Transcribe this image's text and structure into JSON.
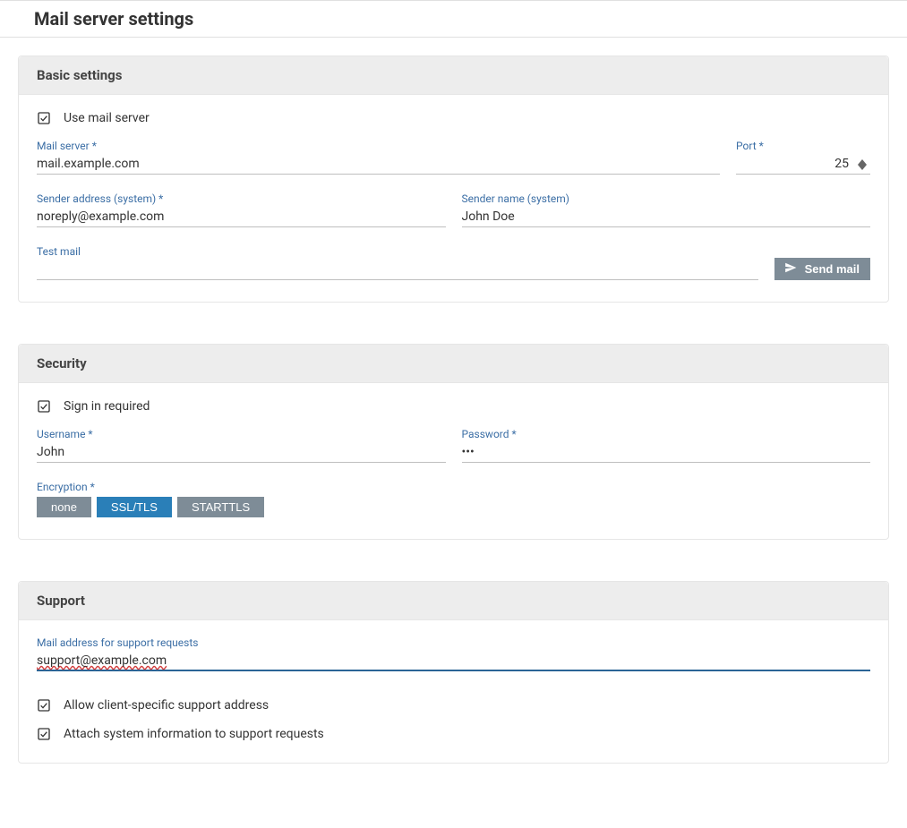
{
  "page": {
    "title": "Mail server settings"
  },
  "basic": {
    "title": "Basic settings",
    "use_mail_server_label": "Use mail server",
    "mail_server_label": "Mail server",
    "mail_server_value": "mail.example.com",
    "port_label": "Port",
    "port_value": "25",
    "sender_address_label": "Sender address (system)",
    "sender_address_value": "noreply@example.com",
    "sender_name_label": "Sender name (system)",
    "sender_name_value": "John Doe",
    "test_mail_label": "Test mail",
    "test_mail_value": "",
    "send_mail_label": "Send mail"
  },
  "security": {
    "title": "Security",
    "sign_in_required_label": "Sign in required",
    "username_label": "Username",
    "username_value": "John",
    "password_label": "Password",
    "password_value": "•••",
    "encryption_label": "Encryption",
    "encryption_options": {
      "none": "none",
      "ssl_tls": "SSL/TLS",
      "starttls": "STARTTLS"
    },
    "encryption_selected": "ssl_tls"
  },
  "support": {
    "title": "Support",
    "mail_address_label": "Mail address for support requests",
    "mail_address_value": "support@example.com",
    "allow_client_specific_label": "Allow client-specific support address",
    "attach_system_info_label": "Attach system information to support requests"
  }
}
